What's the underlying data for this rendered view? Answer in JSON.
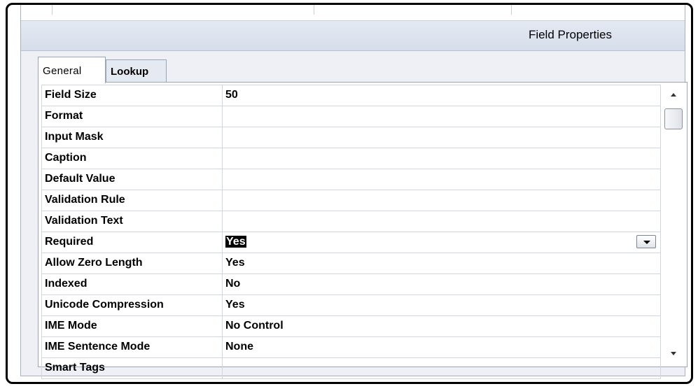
{
  "header": {
    "title": "Field Properties"
  },
  "tabs": [
    {
      "label": "General",
      "active": true
    },
    {
      "label": "Lookup",
      "active": false
    }
  ],
  "properties": [
    {
      "name": "Field Size",
      "value": "50"
    },
    {
      "name": "Format",
      "value": ""
    },
    {
      "name": "Input Mask",
      "value": ""
    },
    {
      "name": "Caption",
      "value": ""
    },
    {
      "name": "Default Value",
      "value": ""
    },
    {
      "name": "Validation Rule",
      "value": ""
    },
    {
      "name": "Validation Text",
      "value": ""
    },
    {
      "name": "Required",
      "value": "Yes",
      "selected": true
    },
    {
      "name": "Allow Zero Length",
      "value": "Yes"
    },
    {
      "name": "Indexed",
      "value": "No"
    },
    {
      "name": "Unicode Compression",
      "value": "Yes"
    },
    {
      "name": "IME Mode",
      "value": "No Control"
    },
    {
      "name": "IME Sentence Mode",
      "value": "None"
    },
    {
      "name": "Smart Tags",
      "value": ""
    }
  ],
  "icons": {
    "dropdown": "chevron-down-icon",
    "scroll_up": "scroll-up-arrow-icon",
    "scroll_down": "scroll-down-arrow-icon"
  },
  "colors": {
    "selection_bg": "#000000",
    "selection_fg": "#ffffff",
    "header_bg": "#dde3ee"
  }
}
